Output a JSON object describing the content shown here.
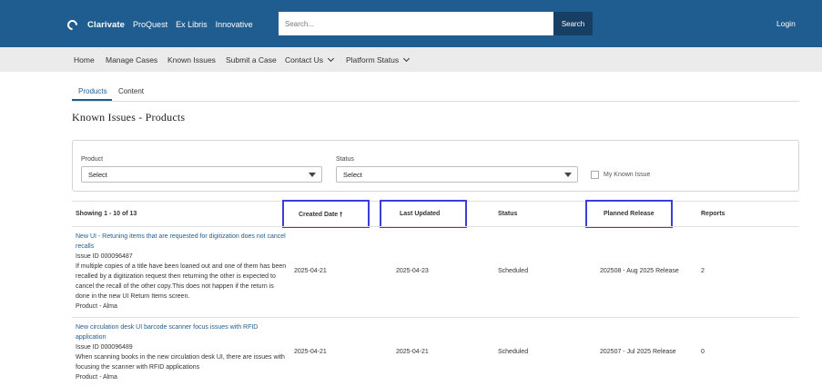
{
  "header": {
    "brand": [
      "Clarivate",
      "ProQuest",
      "Ex Libris",
      "Innovative"
    ],
    "search_placeholder": "Search...",
    "search_button": "Search",
    "login": "Login"
  },
  "nav": {
    "items": [
      "Home",
      "Manage Cases",
      "Known Issues",
      "Submit a Case",
      "Contact Us",
      "Platform Status"
    ]
  },
  "tabs": [
    "Products",
    "Content"
  ],
  "page_title": "Known Issues - Products",
  "filters": {
    "product_label": "Product",
    "product_value": "Select",
    "status_label": "Status",
    "status_value": "Select",
    "my_known_issue_label": "My Known Issue"
  },
  "table": {
    "showing": "Showing 1 - 10 of 13",
    "columns": {
      "created": "Created Date",
      "updated": "Last Updated",
      "status": "Status",
      "planned": "Planned Release",
      "reports": "Reports"
    },
    "sort_indicator": "🠕",
    "rows": [
      {
        "title": "New UI - Retuning items that are requested for digitization does not cancel recalls",
        "issue_id": "Issue ID 000096487",
        "description": "If multiple copies of a title have been loaned out and one of them has been recalled by a digitization request then returning the other is expected to cancel the recall of the other copy.This does not happen if the return is done in the new UI Return Items screen.",
        "product": "Product - Alma",
        "created": "2025-04-21",
        "updated": "2025-04-23",
        "status": "Scheduled",
        "planned": "202508 - Aug 2025 Release",
        "reports": "2"
      },
      {
        "title": "New circulation desk UI barcode scanner focus issues with RFID application",
        "issue_id": "Issue ID 000096489",
        "description": "When scanning books in the new circulation desk UI, there are issues with focusing the scanner with RFID applications",
        "product": "Product - Alma",
        "created": "2025-04-21",
        "updated": "2025-04-21",
        "status": "Scheduled",
        "planned": "202507 - Jul 2025 Release",
        "reports": "0"
      }
    ]
  },
  "colors": {
    "header_bg": "#1f5c8f",
    "search_btn": "#173e63",
    "highlight": "#3b3fd6",
    "link": "#1f5c8f"
  }
}
